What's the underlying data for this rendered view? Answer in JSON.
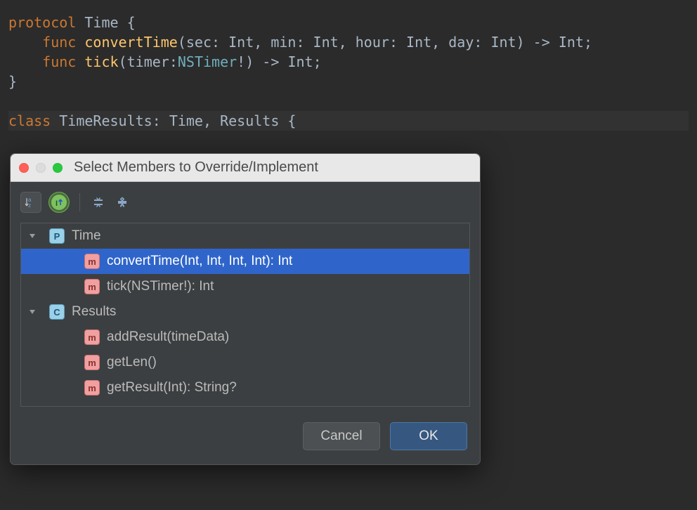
{
  "code": {
    "l1": {
      "kw": "protocol",
      "name": "Time",
      "brace": " {"
    },
    "l2": {
      "indent": "    ",
      "kw": "func",
      "fn": "convertTime",
      "open": "(",
      "p1n": "sec",
      "p1t": "Int",
      "p2n": "min",
      "p2t": "Int",
      "p3n": "hour",
      "p3t": "Int",
      "p4n": "day",
      "p4t": "Int",
      "close": ") -> ",
      "ret": "Int",
      "semi": ";"
    },
    "l3": {
      "indent": "    ",
      "kw": "func",
      "fn": "tick",
      "open": "(",
      "p1n": "timer",
      "p1t": "NSTimer",
      "bang": "!",
      "close": ") -> ",
      "ret": "Int",
      "semi": ";"
    },
    "l4": "}",
    "l5": "",
    "l6": {
      "kw": "class",
      "name": "TimeResults",
      "colon": ": ",
      "proto1": "Time",
      "comma": ", ",
      "proto2": "Results",
      "brace": " {"
    }
  },
  "dialog": {
    "title": "Select Members to Override/Implement",
    "buttons": {
      "cancel": "Cancel",
      "ok": "OK"
    },
    "tree": [
      {
        "kind": "P",
        "label": "Time",
        "level": 1,
        "expandable": true,
        "selected": false
      },
      {
        "kind": "m",
        "label": "convertTime(Int, Int, Int, Int): Int",
        "level": 2,
        "expandable": false,
        "selected": true
      },
      {
        "kind": "m",
        "label": "tick(NSTimer!): Int",
        "level": 2,
        "expandable": false,
        "selected": false
      },
      {
        "kind": "C",
        "label": "Results",
        "level": 1,
        "expandable": true,
        "selected": false
      },
      {
        "kind": "m",
        "label": "addResult(timeData)",
        "level": 2,
        "expandable": false,
        "selected": false
      },
      {
        "kind": "m",
        "label": "getLen()",
        "level": 2,
        "expandable": false,
        "selected": false
      },
      {
        "kind": "m",
        "label": "getResult(Int): String?",
        "level": 2,
        "expandable": false,
        "selected": false
      }
    ]
  }
}
